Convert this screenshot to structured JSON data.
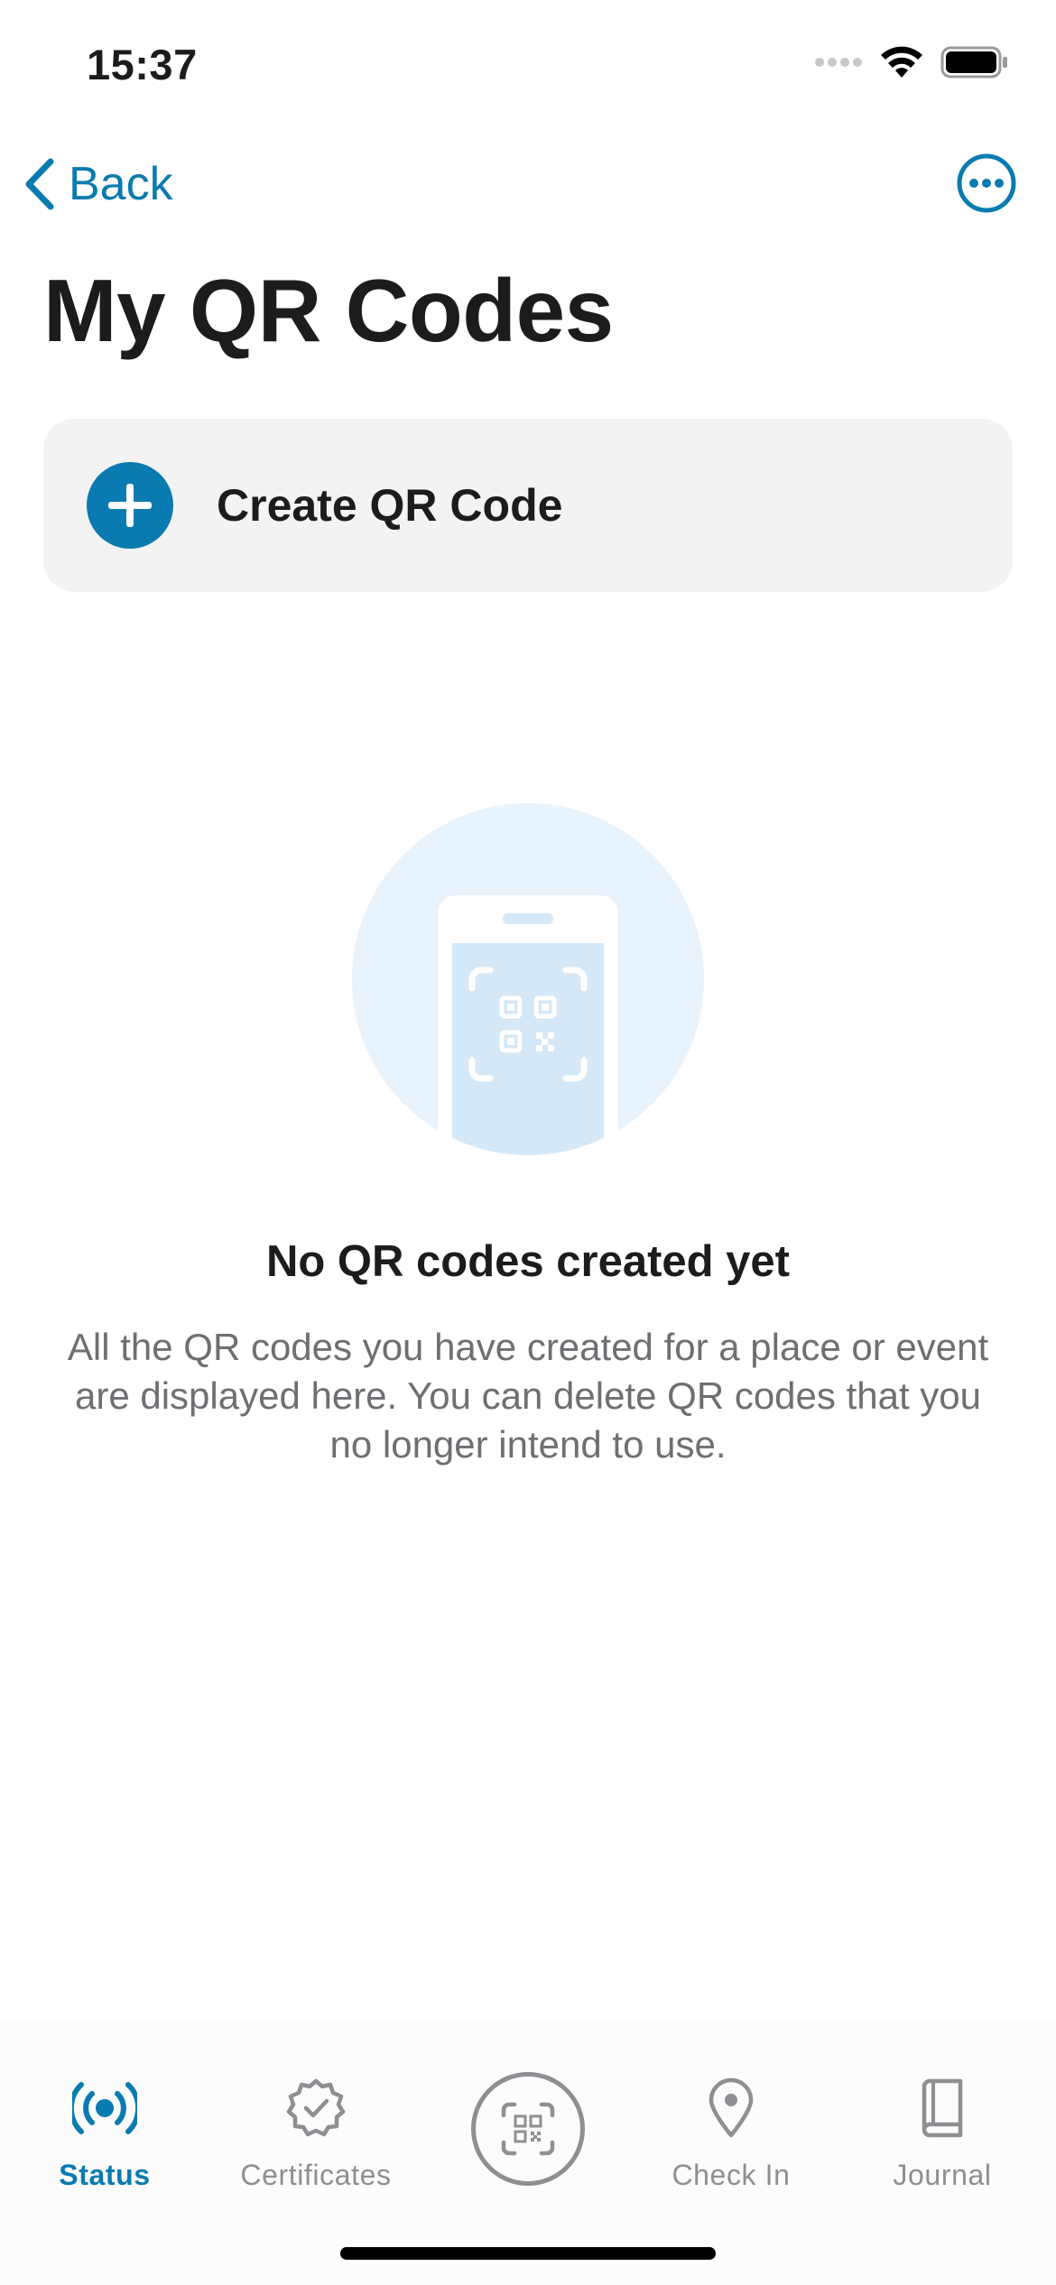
{
  "status_bar": {
    "time": "15:37",
    "icons": [
      "signal-dots-icon",
      "wifi-icon",
      "battery-icon"
    ]
  },
  "nav": {
    "back_label": "Back",
    "more_icon": "ellipsis-circle-icon"
  },
  "page": {
    "title": "My QR Codes"
  },
  "create_card": {
    "label": "Create QR Code",
    "icon": "plus-circle-icon"
  },
  "empty_state": {
    "illustration": "phone-qr-illustration",
    "title": "No QR codes created yet",
    "body": "All the QR codes you have created for a place or event are displayed here. You can delete QR codes that you no longer intend to use."
  },
  "tab_bar": {
    "tabs": [
      {
        "label": "Status",
        "icon": "broadcast-icon",
        "active": true
      },
      {
        "label": "Certificates",
        "icon": "certificate-badge-icon",
        "active": false
      },
      {
        "label": "",
        "icon": "qr-scan-icon",
        "active": false
      },
      {
        "label": "Check In",
        "icon": "location-pin-icon",
        "active": false
      },
      {
        "label": "Journal",
        "icon": "book-icon",
        "active": false
      }
    ]
  },
  "colors": {
    "accent": "#0a7bb0",
    "card_background": "#f3f3f3",
    "illustration_light": "#e8f3fc",
    "illustration_mid": "#d4e8f7",
    "inactive": "#8e8e93",
    "text_primary": "#1c1c1e",
    "text_secondary": "#6e6e73"
  }
}
